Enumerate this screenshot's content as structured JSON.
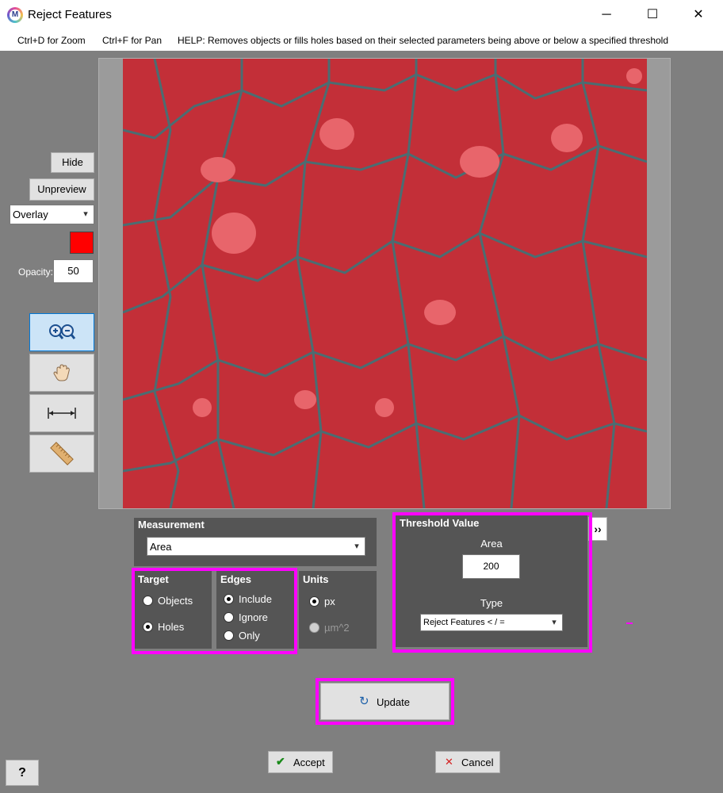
{
  "window": {
    "title": "Reject Features",
    "app_icon_letter": "M",
    "minimize_glyph": "─",
    "maximize_glyph": "☐",
    "close_glyph": "✕"
  },
  "menu": {
    "zoom_hint": "Ctrl+D for Zoom",
    "pan_hint": "Ctrl+F for Pan",
    "help": "HELP:  Removes objects or fills holes based on their selected parameters being above or below a specified threshold"
  },
  "preview_controls": {
    "hide_label": "Hide",
    "unpreview_label": "Unpreview",
    "display_mode": "Overlay",
    "overlay_color": "#ff0000",
    "opacity_label": "Opacity:",
    "opacity_value": "50"
  },
  "tools": [
    "zoom-icon",
    "pan-hand-icon",
    "measure-line-icon",
    "ruler-icon"
  ],
  "measurement": {
    "title": "Measurement",
    "selected": "Area"
  },
  "target": {
    "title": "Target",
    "options": [
      "Objects",
      "Holes"
    ],
    "selected": "Holes"
  },
  "edges": {
    "title": "Edges",
    "options": [
      "Include",
      "Ignore",
      "Only"
    ],
    "selected": "Include"
  },
  "units": {
    "title": "Units",
    "options": [
      "px",
      "µm^2"
    ],
    "selected": "px"
  },
  "threshold": {
    "title": "Threshold Value",
    "param_label": "Area",
    "value": "200",
    "type_label": "Type",
    "type_selected": "Reject Features < / ="
  },
  "expand_glyph": "››",
  "actions": {
    "update_label": "Update",
    "accept_label": "Accept",
    "cancel_label": "Cancel",
    "help_label": "?"
  },
  "colors": {
    "highlight": "#ff00ff",
    "panel_bg": "#555555",
    "overlay_red": "#c5303a"
  }
}
